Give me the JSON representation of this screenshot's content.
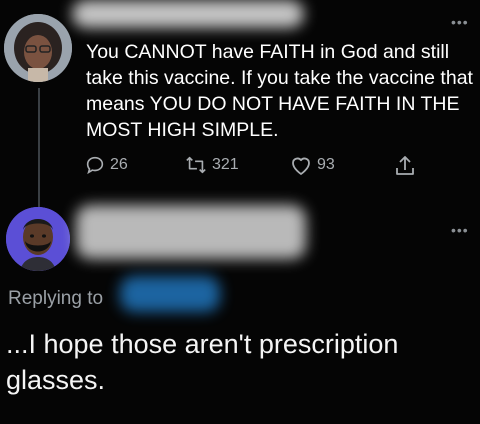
{
  "tweet": {
    "text": "You CANNOT have FAITH in God and still take this vaccine. If you take the vaccine that means YOU DO NOT HAVE FAITH IN THE MOST HIGH SIMPLE.",
    "reply_count": "26",
    "retweet_count": "321",
    "like_count": "93",
    "more_icon": "more-horizontal-icon"
  },
  "reply": {
    "replying_to_label": "Replying to",
    "text": "...I hope those aren't prescription glasses.",
    "more_icon": "more-horizontal-icon"
  },
  "colors": {
    "background": "#050505",
    "text": "#ffffff",
    "muted": "#a9adb1",
    "avatar_bg": "#5b4fd6"
  }
}
